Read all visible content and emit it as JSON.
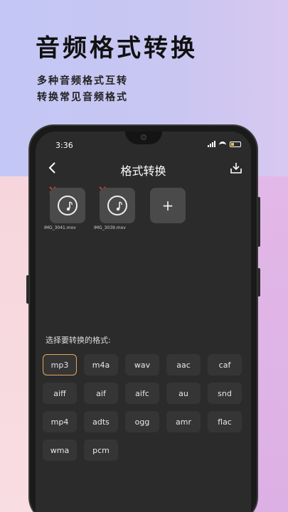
{
  "promo": {
    "headline": "音频格式转换",
    "sub1": "多种音频格式互转",
    "sub2": "转换常见音频格式"
  },
  "status": {
    "time": "3:36"
  },
  "navbar": {
    "title": "格式转换",
    "back_icon": "chevron-left-icon",
    "download_icon": "download-icon"
  },
  "files": [
    {
      "name": "IMG_3041.mov"
    },
    {
      "name": "IMG_3039.mov"
    }
  ],
  "add_label": "+",
  "formats_label": "选择要转换的格式:",
  "formats": [
    "mp3",
    "m4a",
    "wav",
    "aac",
    "caf",
    "aiff",
    "aif",
    "aifc",
    "au",
    "snd",
    "mp4",
    "adts",
    "ogg",
    "amr",
    "flac",
    "wma",
    "pcm"
  ],
  "selected_format": "mp3",
  "colors": {
    "accent": "#e5a65a",
    "delete": "#e04040"
  }
}
